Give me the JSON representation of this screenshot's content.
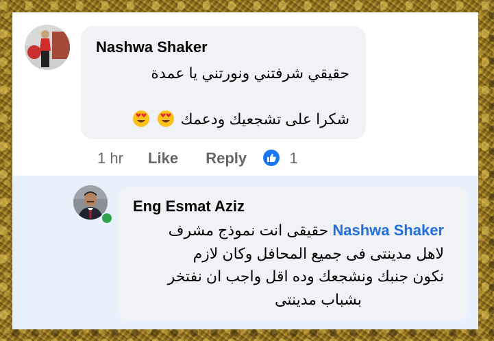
{
  "comment": {
    "author": "Nashwa Shaker",
    "line1": "حقيقي شرفتني ونورتني يا عمدة",
    "line2": "شكرا على تشجعيك ودعمك",
    "emoji": "heart-eyes-emoji",
    "time": "1 hr",
    "like_label": "Like",
    "reply_label": "Reply",
    "reaction_count": "1"
  },
  "reply": {
    "author": "Eng Esmat Aziz",
    "mention": "Nashwa Shaker",
    "line1_text": "حقيقى انت نموذج مشرف",
    "line2": "لاهل مدينتى فى جميع المحافل وكان لازم",
    "line3": "نكون جنبك ونشجعك وده اقل واجب ان نفتخر",
    "line4": "بشباب مدينتى",
    "online": true
  },
  "colors": {
    "bubble": "#f0f2f5",
    "reply_background": "#e7f0fb",
    "mention": "#216fdb",
    "like_blue": "#1877f2",
    "online_green": "#31a24c"
  }
}
